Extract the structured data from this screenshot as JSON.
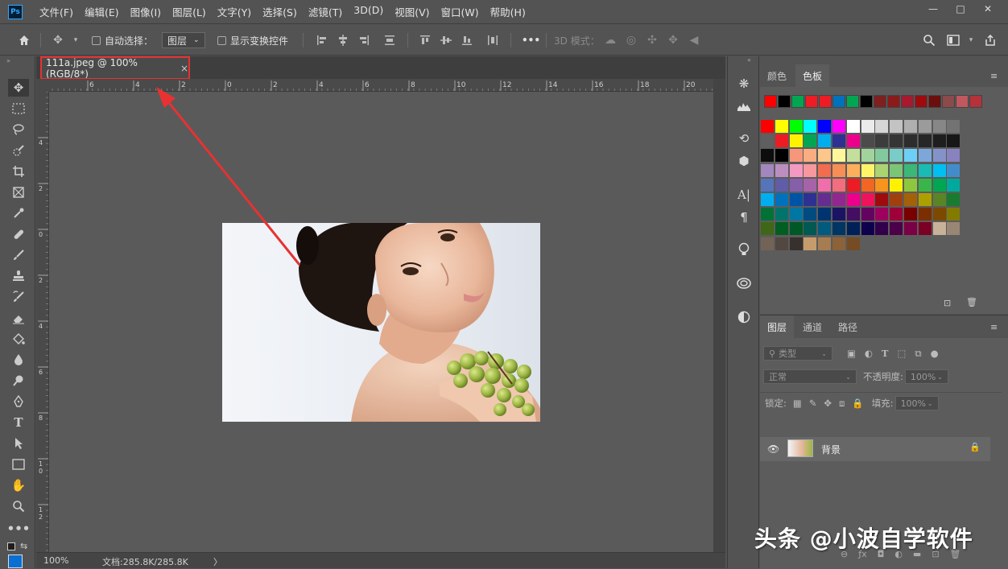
{
  "app": {
    "logo": "Ps"
  },
  "menu": [
    "文件(F)",
    "编辑(E)",
    "图像(I)",
    "图层(L)",
    "文字(Y)",
    "选择(S)",
    "滤镜(T)",
    "3D(D)",
    "视图(V)",
    "窗口(W)",
    "帮助(H)"
  ],
  "window_controls": {
    "minimize": "—",
    "maximize": "□",
    "close": "✕"
  },
  "options": {
    "auto_select_label": "自动选择：",
    "auto_select_value": "图层",
    "show_transform_label": "显示变换控件",
    "more": "•••",
    "mode_3d_label": "3D 模式："
  },
  "document": {
    "tab_title": "111a.jpeg @ 100%(RGB/8*)",
    "tab_close": "×",
    "zoom": "100%",
    "doc_info": "文档:285.8K/285.8K",
    "status_arrow": "〉"
  },
  "rulers": {
    "horizontal": [
      "6",
      "4",
      "2",
      "0",
      "2",
      "4",
      "6",
      "8",
      "10",
      "12",
      "14",
      "16",
      "18",
      "20"
    ],
    "vertical": [
      "4",
      "2",
      "0",
      "2",
      "4",
      "6",
      "8",
      "1\n0",
      "1\n2"
    ]
  },
  "swatch_panel": {
    "tabs": [
      "颜色",
      "色板"
    ],
    "active_tab": "色板",
    "recent": [
      "#ff0000",
      "#000000",
      "#00a650",
      "#ee1c24",
      "#ed1c24",
      "#0072bc",
      "#00a651",
      "#000000",
      "#7f1f1f",
      "#8b1a1a",
      "#a6192e",
      "#9e0b0f",
      "#6b0e0e",
      "#8c4a4a",
      "#c1585f",
      "#b5323a"
    ],
    "rows": [
      [
        "#ff0000",
        "#ffff00",
        "#00ff00",
        "#00ffff",
        "#0000ff",
        "#ff00ff",
        "#ffffff",
        "#ebebeb",
        "#d7d7d7",
        "#c3c3c3",
        "#afafaf",
        "#9b9b9b",
        "#878787",
        "#737373"
      ],
      [
        "#5f5f5f",
        "#ed1c24",
        "#fff200",
        "#00a651",
        "#00aeef",
        "#2e3192",
        "#ec008c",
        "#4b4b4b",
        "#3c3c3c",
        "#353535",
        "#2d2d2d",
        "#262626",
        "#1e1e1e",
        "#171717"
      ],
      [
        "#0d0d0d",
        "#000000",
        "#f7977a",
        "#f9ad81",
        "#fdc68a",
        "#fff79a",
        "#c4df9b",
        "#a3d39c",
        "#82ca9d",
        "#7accc8",
        "#6dcff6",
        "#7da7d9",
        "#8393ca",
        "#8882be"
      ],
      [
        "#a187be",
        "#bc8dbf",
        "#f49ac2",
        "#f6989d",
        "#f26c4f",
        "#f68e55",
        "#fbaf5c",
        "#fff467",
        "#acd372",
        "#7cc576",
        "#3bb878",
        "#1abbb4",
        "#00bff3",
        "#438ccb"
      ],
      [
        "#5574b9",
        "#605ca8",
        "#855fa8",
        "#a763a8",
        "#f06ea9",
        "#f26d7d",
        "#ed1c24",
        "#f26522",
        "#f7941d",
        "#fff200",
        "#8dc73f",
        "#39b54a",
        "#00a651",
        "#00a99d"
      ],
      [
        "#00aeef",
        "#0072bc",
        "#0054a6",
        "#2e3192",
        "#662d91",
        "#92278f",
        "#ec008c",
        "#ed145b",
        "#9e0b0f",
        "#a0410d",
        "#a36209",
        "#aba000",
        "#598527",
        "#197b30"
      ],
      [
        "#007236",
        "#00746b",
        "#0076a3",
        "#004b80",
        "#003471",
        "#1b1464",
        "#440e62",
        "#630460",
        "#9e005d",
        "#9e0039",
        "#790000",
        "#7b2e00",
        "#7d4900",
        "#827b00"
      ],
      [
        "#406618",
        "#005e20",
        "#005826",
        "#005952",
        "#005b7f",
        "#003663",
        "#002157",
        "#0d004c",
        "#32004b",
        "#4b0049",
        "#7b0046",
        "#7a0026",
        "#c7b299",
        "#998675"
      ],
      [
        "#736357",
        "#534741",
        "#37302d",
        "#c69c6d",
        "#a67c52",
        "#8c6239",
        "#754c24"
      ]
    ]
  },
  "layers_panel": {
    "tabs": [
      "图层",
      "通道",
      "路径"
    ],
    "active_tab": "图层",
    "filter_label": "类型",
    "blend_mode": "正常",
    "opacity_label": "不透明度:",
    "opacity_value": "100%",
    "lock_label": "锁定:",
    "fill_label": "填充:",
    "fill_value": "100%",
    "layers": [
      {
        "name": "背景",
        "visible": true,
        "locked": true
      }
    ]
  },
  "watermark": "头条 @小波自学软件",
  "colors": {
    "accent_red": "#e63232",
    "ps_blue": "#31a8ff",
    "foreground": "#0a6fd2",
    "background": "#ffffff"
  }
}
